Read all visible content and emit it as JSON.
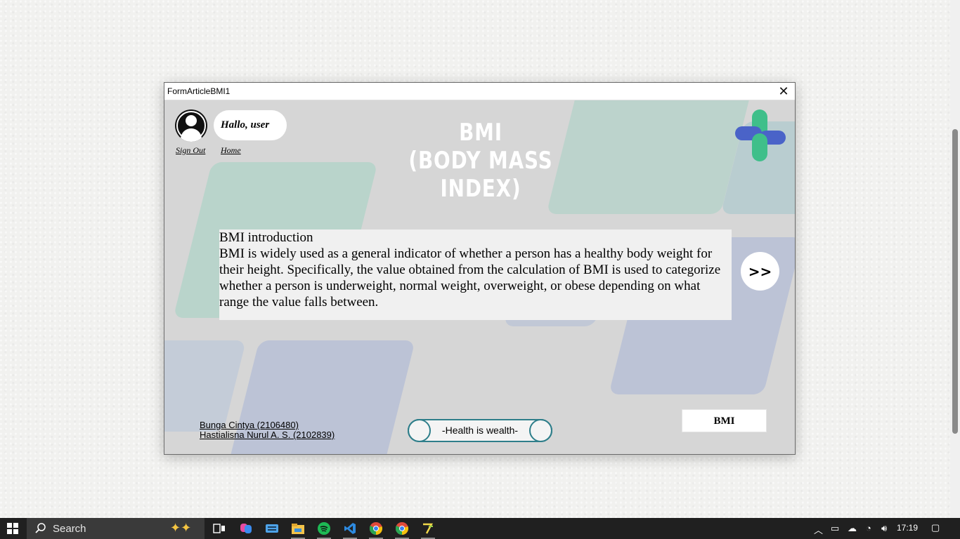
{
  "window": {
    "title": "FormArticleBMI1",
    "close_glyph": "✕"
  },
  "header": {
    "greeting": "Hallo, user",
    "sign_out": "Sign Out",
    "home": "Home",
    "title_line1": "BMI",
    "title_line2": "(BODY MASS INDEX)"
  },
  "article": {
    "heading": "BMI introduction",
    "body": "BMI is widely used as a general indicator of whether a person has a healthy body weight for their height. Specifically, the value obtained from the calculation of BMI is used to categorize whether a person is underweight, normal weight, overweight, or obese depending on what range the value falls between."
  },
  "next_button": {
    "label": ">>"
  },
  "footer": {
    "credit_1": "Bunga Cintya (2106480)",
    "credit_2": "Hastialisna Nurul A. S. (2102839)",
    "motto": "-Health is wealth-",
    "bmi_button": "BMI"
  },
  "taskbar": {
    "search_placeholder": "Search",
    "clock": "17:19",
    "apps": [
      "task-view",
      "copilot",
      "keyboard",
      "file-explorer",
      "spotify",
      "vscode",
      "chrome",
      "chrome",
      "tab-app"
    ]
  },
  "colors": {
    "accent_green": "#3fbf8a",
    "accent_blue": "#4a63c8",
    "motto_border": "#2e7e8a"
  }
}
